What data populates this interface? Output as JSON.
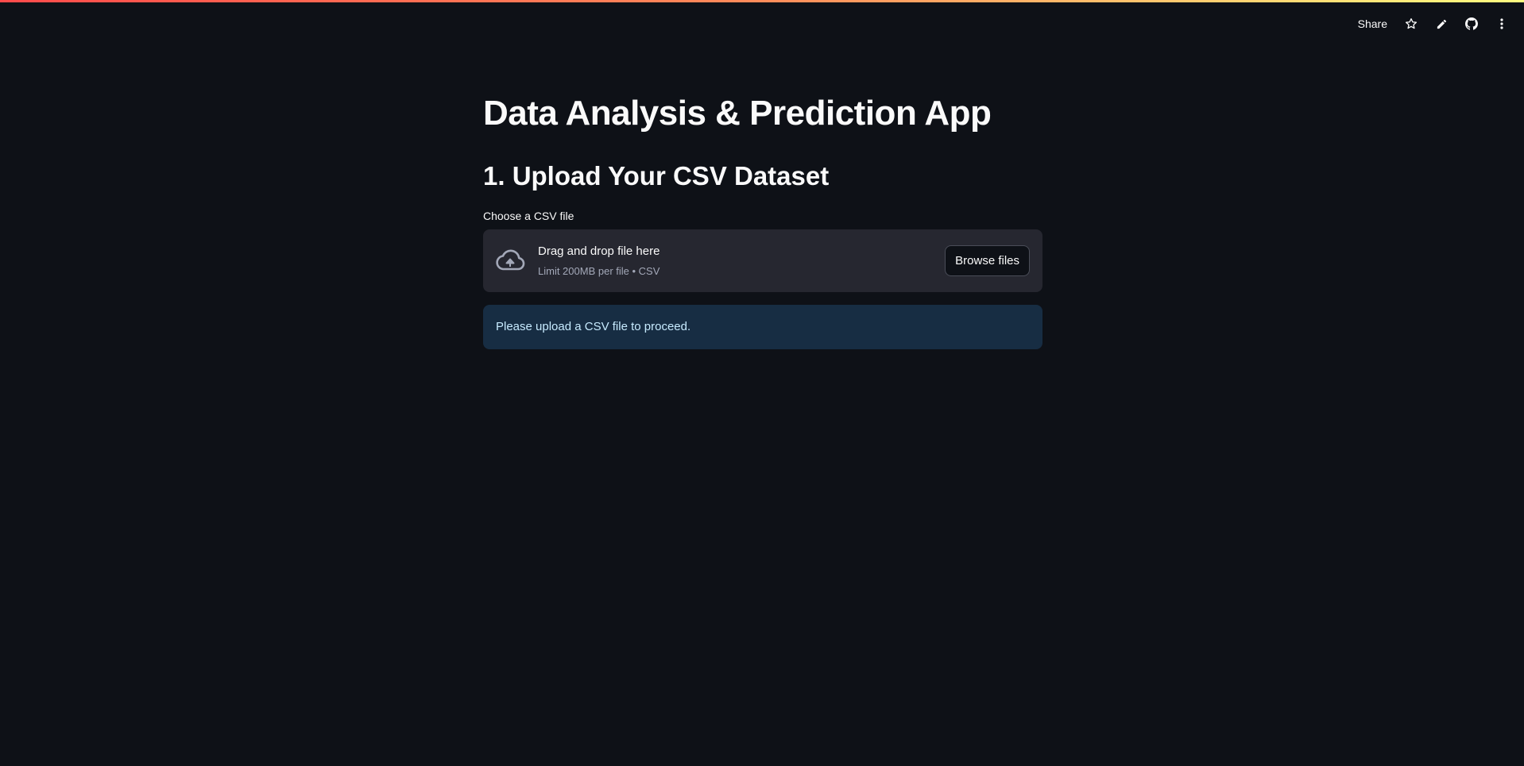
{
  "header": {
    "share_label": "Share",
    "icons": [
      "star-icon",
      "pencil-icon",
      "github-icon",
      "more-vertical-icon"
    ]
  },
  "main": {
    "title": "Data Analysis & Prediction App",
    "section_title": "1. Upload Your CSV Dataset",
    "uploader": {
      "label": "Choose a CSV file",
      "drop_text": "Drag and drop file here",
      "limit_text": "Limit 200MB per file • CSV",
      "browse_label": "Browse files"
    },
    "info_message": "Please upload a CSV file to proceed."
  },
  "colors": {
    "background": "#0e1117",
    "dropzone": "#262730",
    "info_background": "#172d43",
    "info_text": "#c7ebff"
  }
}
